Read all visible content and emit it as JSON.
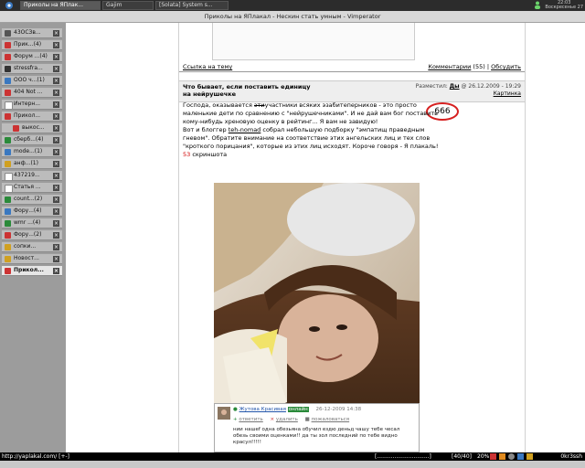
{
  "taskbar": {
    "tasks": [
      {
        "label": "Приколы на ЯПлак...",
        "active": true
      },
      {
        "label": "Gajim",
        "active": false
      },
      {
        "label": "[Solata] System s...",
        "active": false
      }
    ],
    "clock_time": "22:03",
    "clock_day": "Воскресенье 27"
  },
  "window": {
    "title": "Приколы на ЯПлакал - Нескин стать умным - Vimperator"
  },
  "tabs": [
    {
      "label": "43ОСЗв...",
      "count": "",
      "active": false
    },
    {
      "label": "Прик...",
      "count": "(4)",
      "active": false
    },
    {
      "label": "Форум ...",
      "count": "(4)",
      "active": false
    },
    {
      "label": "stressfra...",
      "count": "",
      "active": false
    },
    {
      "label": "ООО ч...",
      "count": "(1)",
      "active": false
    },
    {
      "label": "404 Not ...",
      "count": "",
      "active": false
    },
    {
      "label": "Интерн...",
      "count": "",
      "active": false
    },
    {
      "label": "Прикол...",
      "count": "",
      "active": false
    },
    {
      "label": "выкос...",
      "count": "",
      "active": false
    },
    {
      "label": "сберб...",
      "count": "(4)",
      "active": false
    },
    {
      "label": "mode...",
      "count": "(1)",
      "active": false
    },
    {
      "label": "анф...",
      "count": "(1)",
      "active": false
    },
    {
      "label": "437219...",
      "count": "",
      "active": false
    },
    {
      "label": "Статья ...",
      "count": "",
      "active": false
    },
    {
      "label": "count...",
      "count": "(2)",
      "active": false
    },
    {
      "label": "Фору...",
      "count": "(4)",
      "active": false
    },
    {
      "label": "wmr ...",
      "count": "(4)",
      "active": false
    },
    {
      "label": "Фору...",
      "count": "(2)",
      "active": false
    },
    {
      "label": "сопки...",
      "count": "",
      "active": false
    },
    {
      "label": "Новост...",
      "count": "",
      "active": false
    },
    {
      "label": "Прикол...",
      "count": "",
      "active": true
    }
  ],
  "previous_post": {
    "link_label": "Ссылка на тему",
    "comments_label": "Комментарии",
    "comments_count": "(55)",
    "discuss_label": "Обсудить"
  },
  "post": {
    "title": "Что бывает, если поставить единицу на нейрушечке",
    "posted_label": "Разместил:",
    "author": "Ды",
    "date": "@ 26.12.2009 - 19:29",
    "picture_label": "Картинка",
    "rating": "666",
    "text_line1": "Господа, оказывается ",
    "text_strike": "эти",
    "text_line1b": "участники всяких эзабитеперников - это просто маленькие дети по сравнению с \"нейрушечниками\". И не дай вам бог поставить кому-нибудь хреновую оценку в рейтинг... Я вам не завидую!",
    "text_line2a": "Вот и блоггер ",
    "text_link": "teh-nomad",
    "text_line2b": " собрал небольшую подборку \"эмпатищ праведным гневом\". Обратите внимание на соответствие этих ангельских лиц и тех слов \"кроткого порицания\", которые из этих лиц исходят. Короче говоря - Я плакаль!",
    "screens_count": "53",
    "screens_label": " скриншота"
  },
  "photo_card": {
    "user": "Жутова Красивая",
    "badge": "онлайн",
    "date": "26-12-2009 14:38",
    "actions": [
      "ответить",
      "удалить",
      "пожаловаться"
    ],
    "comment": "нии нашеf одна обезьяна обучил ездю деньд чашу тебе чесал обезь своими оценками!! да ты зол последний по тебе видно красул!!!!!"
  },
  "status": {
    "url": "http://yaplakal.com/ [+-]",
    "progress": "[..............................]",
    "count": "[40/40]",
    "percent": "20%",
    "speed": "0kr3ssh"
  }
}
